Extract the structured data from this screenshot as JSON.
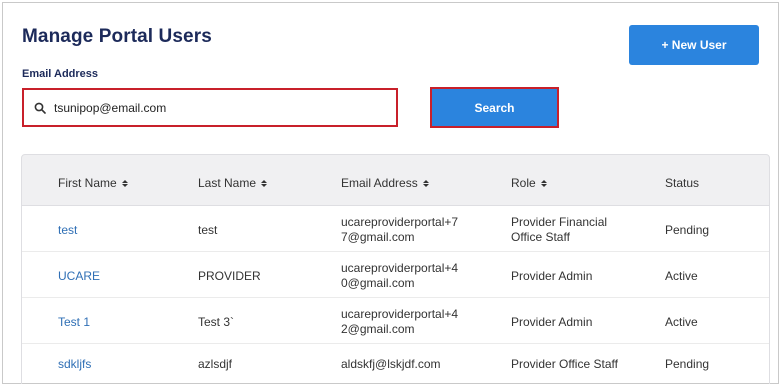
{
  "page_title": "Manage Portal Users",
  "new_user_button": "+ New User",
  "email_label": "Email Address",
  "search": {
    "value": "tsunipop@email.com",
    "button_label": "Search"
  },
  "table": {
    "headers": {
      "first_name": "First Name",
      "last_name": "Last Name",
      "email": "Email Address",
      "role": "Role",
      "status": "Status"
    },
    "rows": [
      {
        "first_name": "test",
        "last_name": "test",
        "email_1": "ucareproviderportal+7",
        "email_2": "7@gmail.com",
        "role_1": "Provider Financial",
        "role_2": "Office Staff",
        "status": "Pending"
      },
      {
        "first_name": "UCARE",
        "last_name": "PROVIDER",
        "email_1": "ucareproviderportal+4",
        "email_2": "0@gmail.com",
        "role_1": "Provider Admin",
        "role_2": "",
        "status": "Active"
      },
      {
        "first_name": "Test 1",
        "last_name": "Test 3`",
        "email_1": "ucareproviderportal+4",
        "email_2": "2@gmail.com",
        "role_1": "Provider Admin",
        "role_2": "",
        "status": "Active"
      },
      {
        "first_name": "sdkljfs",
        "last_name": "azlsdjf",
        "email_1": "aldskfj@lskjdf.com",
        "email_2": "",
        "role_1": "Provider Office Staff",
        "role_2": "",
        "status": "Pending"
      }
    ]
  },
  "colors": {
    "primary_button": "#2b84de",
    "title": "#1c2a5a",
    "link": "#2f6fb5",
    "highlight_border": "#c8202a"
  }
}
